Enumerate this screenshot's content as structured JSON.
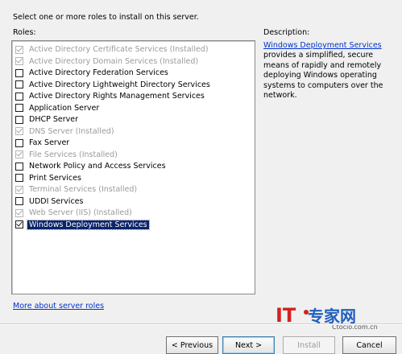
{
  "header": {
    "instruction": "Select one or more roles to install on this server.",
    "roles_label": "Roles:",
    "description_label": "Description:"
  },
  "roles": [
    {
      "label": "Active Directory Certificate Services  (Installed)",
      "checked": true,
      "disabled": true
    },
    {
      "label": "Active Directory Domain Services  (Installed)",
      "checked": true,
      "disabled": true
    },
    {
      "label": "Active Directory Federation Services",
      "checked": false,
      "disabled": false
    },
    {
      "label": "Active Directory Lightweight Directory Services",
      "checked": false,
      "disabled": false
    },
    {
      "label": "Active Directory Rights Management Services",
      "checked": false,
      "disabled": false
    },
    {
      "label": "Application Server",
      "checked": false,
      "disabled": false
    },
    {
      "label": "DHCP Server",
      "checked": false,
      "disabled": false
    },
    {
      "label": "DNS Server  (Installed)",
      "checked": true,
      "disabled": true
    },
    {
      "label": "Fax Server",
      "checked": false,
      "disabled": false
    },
    {
      "label": "File Services  (Installed)",
      "checked": true,
      "disabled": true
    },
    {
      "label": "Network Policy and Access Services",
      "checked": false,
      "disabled": false
    },
    {
      "label": "Print Services",
      "checked": false,
      "disabled": false
    },
    {
      "label": "Terminal Services  (Installed)",
      "checked": true,
      "disabled": true
    },
    {
      "label": "UDDI Services",
      "checked": false,
      "disabled": false
    },
    {
      "label": "Web Server (IIS)  (Installed)",
      "checked": true,
      "disabled": true
    },
    {
      "label": "Windows Deployment Services",
      "checked": true,
      "disabled": false,
      "selected": true
    }
  ],
  "description": {
    "link": "Windows Deployment Services",
    "text": "provides a simplified, secure means of rapidly and remotely deploying Windows operating systems to computers over the network."
  },
  "more_link": "More about server roles",
  "buttons": {
    "previous": "< Previous",
    "next": "Next >",
    "install": "Install",
    "cancel": "Cancel"
  },
  "watermark": {
    "it": "IT",
    "brand": "专家网",
    "site": "Ctocio.com.cn"
  },
  "colors": {
    "selection": "#0a246a",
    "link": "#0033cc",
    "watermark_red": "#d42020",
    "watermark_blue": "#1f5fbf"
  }
}
